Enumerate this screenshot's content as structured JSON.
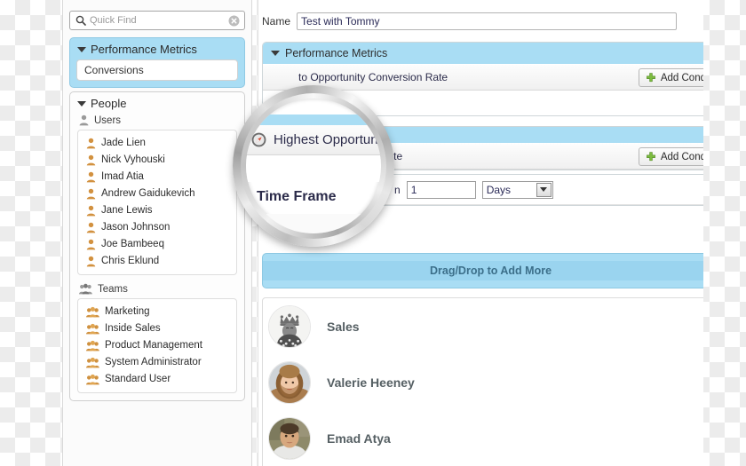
{
  "sidebar": {
    "quick_find": {
      "value": "",
      "placeholder": "Quick Find",
      "search_icon": "search-icon",
      "clear_icon": "clear-circle-icon"
    },
    "groups": [
      {
        "title": "Performance Metrics",
        "selected": true,
        "items": [
          "Conversions"
        ]
      }
    ],
    "people_group": {
      "title": "People",
      "users_label": "Users",
      "users": [
        "Jade Lien",
        "Nick Vyhouski",
        "Imad Atia",
        "Andrew Gaidukevich",
        "Jane Lewis",
        "Jason Johnson",
        "Joe Bambeeq",
        "Chris Eklund"
      ],
      "teams_label": "Teams",
      "teams": [
        "Marketing",
        "Inside Sales",
        "Product Management",
        "System Administrator",
        "Standard User"
      ]
    }
  },
  "content": {
    "name_label": "Name",
    "name_value": "Test with Tommy",
    "name_placeholder": "",
    "card": {
      "header": "Performance Metrics",
      "rows": [
        {
          "label": "to Opportunity Conversion Rate",
          "button": "Add Cond"
        },
        {
          "label": "Won Conversion Rate",
          "button": "Add Cond"
        }
      ]
    },
    "timeframe": {
      "prefix": "n",
      "number": "1",
      "unit": "Days"
    },
    "dragdrop_label": "Drag/Drop to Add More",
    "people": [
      {
        "name": "Sales",
        "avatar": "king-portrait-avatar"
      },
      {
        "name": "Valerie Heeney",
        "avatar": "woman-photo-avatar"
      },
      {
        "name": "Emad Atya",
        "avatar": "man-photo-avatar"
      }
    ]
  },
  "magnifier": {
    "icon": "compass-icon",
    "line1": "Highest Opportuni",
    "line2": "Time Frame"
  },
  "colors": {
    "accent_blue": "#a9ddf4",
    "panel_bg": "#fbfbfb",
    "text": "#2b2b4a",
    "plus_green": "#7cbb3f"
  }
}
